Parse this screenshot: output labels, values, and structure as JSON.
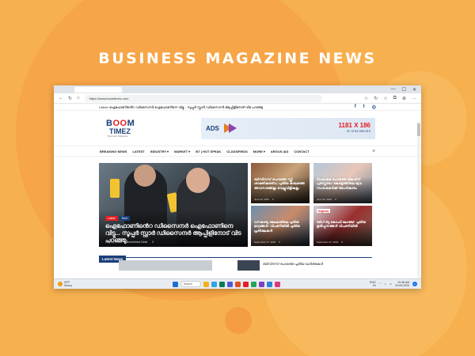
{
  "heading": "BUSINESS MAGAZINE NEWS",
  "browser": {
    "url": "https://www.boomtimez.com",
    "window_controls": [
      "—",
      "☐",
      "✕"
    ],
    "nav_icons": [
      "←",
      "↻",
      "⌂"
    ],
    "tool_icons": [
      "☆",
      "↻",
      "☆",
      "⧉",
      "⊕",
      "…"
    ]
  },
  "site": {
    "ticker": "Latest: ഐഫോണിൻെറ ഡിസൈനർ ഐഫോണിനെ വിട്ടു... സൂപ്പർ സ്റ്റാർ ഡിസൈനർ ആപ്പിളിനോട് വിട പറഞ്ഞു",
    "social": [
      "f",
      "t",
      "◎"
    ],
    "logo": {
      "line1_a": "B",
      "line1_o": "OO",
      "line1_b": "M",
      "line2": "TIMEZ",
      "line3": "Business Magazine"
    },
    "ad": {
      "label": "ADS",
      "number": "1181 X 186",
      "phone": "☏ 9744 999 513"
    },
    "nav": [
      "BREAKING NEWS",
      "LATEST",
      "INDUSTRY ▾",
      "MARKET ▾",
      "BT | HOT SPEAK",
      "CLASSIFIEDS",
      "MORE ▾",
      "ARGUS IAD",
      "CONTACT"
    ],
    "hero": {
      "tags": [
        "Latest",
        "Tech"
      ],
      "title": "ഐഫോണിൻെറ ഡിസൈനർ ഐഫോണിനെ വിട്ടു... സൂപ്പർ സ്റ്റാർ ഡിസൈനർ ആപ്പിളിനോട് വിട പറഞ്ഞു",
      "date": "July 13, 2022",
      "author": "Boomtimez Desk",
      "count": "0"
    },
    "cards": [
      {
        "title": "ബിസിനസ് രംഗത്തെ സ്ത്രീ ശാക്തീകരണം: പുതിയ കാലത്തെ അവസരങ്ങളും വെല്ലുവിളികളും",
        "date": "June 22, 2022",
        "count": "0"
      },
      {
        "title": "സംരംഭക രംഗത്തെ മികവിന് പുരസ്കാരം: കേരളത്തിലെ യുവ സംരംഭകർക്ക് അംഗീകാരം",
        "date": "June 22, 2022",
        "count": "0"
      },
      {
        "title": "ധനകാര്യ മേഖലയിലെ പുതിയ മാറ്റങ്ങൾ: വിപണിയിൽ പുതിയ പ്രതീക്ഷകൾ",
        "date": "September 27, 2022",
        "count": "0"
      },
      {
        "brand": "bigboo",
        "title": "ബിഗ് ബൂ കോഫി ലോഞ്ച്: പുതിയ ഉൽപ്പന്നങ്ങൾ വിപണിയിൽ",
        "date": "September 27, 2022",
        "count": "0"
      }
    ],
    "latest_label": "Latest News",
    "latest_text": "ബിസിനസ് രംഗത്തെ പുതിയ വാർത്തകൾ"
  },
  "taskbar": {
    "temp": "30°F",
    "condition": "Sunny",
    "search": "Search",
    "lang": "ENG",
    "region": "IN",
    "time": "10:46 AM",
    "date": "29-09-2023",
    "badge": "1",
    "app_colors": [
      "#1f6fd1",
      "#f3b21b",
      "#2fa4e7",
      "#0a7b52",
      "#4f5bd5",
      "#e34f26",
      "#e31e24",
      "#22a55b",
      "#7f3fbf",
      "#2b87d1",
      "#d93b7a"
    ]
  }
}
